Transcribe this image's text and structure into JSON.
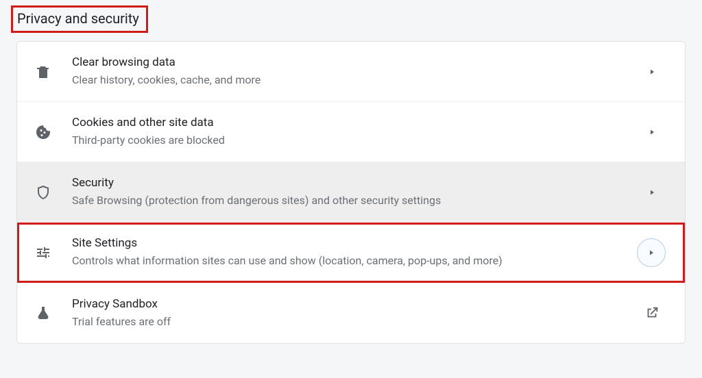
{
  "section": {
    "title": "Privacy and security"
  },
  "rows": {
    "clear": {
      "title": "Clear browsing data",
      "desc": "Clear history, cookies, cache, and more"
    },
    "cookies": {
      "title": "Cookies and other site data",
      "desc": "Third-party cookies are blocked"
    },
    "security": {
      "title": "Security",
      "desc": "Safe Browsing (protection from dangerous sites) and other security settings"
    },
    "site": {
      "title": "Site Settings",
      "desc": "Controls what information sites can use and show (location, camera, pop-ups, and more)"
    },
    "sandbox": {
      "title": "Privacy Sandbox",
      "desc": "Trial features are off"
    }
  }
}
